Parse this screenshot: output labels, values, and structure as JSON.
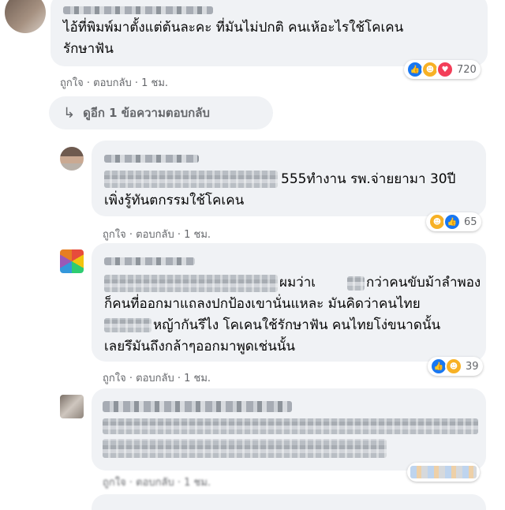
{
  "comments": [
    {
      "text_lines": [
        "ไอ้ที่พิมพ์มาตั้งแต่ต้นละคะ ที่มันไม่ปกติ คนเห้อะไรใช้โคเคน",
        "รักษาฟัน"
      ],
      "like_label": "ถูกใจ",
      "reply_label": "ตอบกลับ",
      "time": "1 ชม.",
      "reaction_icons": [
        "like-icon",
        "haha-icon",
        "love-icon"
      ],
      "reaction_count": "720"
    },
    {
      "text_lines": [
        "555ทำงาน รพ.จ่ายยามา 30ปี",
        "เพิ่งรู้ทันตกรรมใช้โคเคน"
      ],
      "like_label": "ถูกใจ",
      "reply_label": "ตอบกลับ",
      "time": "1 ชม.",
      "reaction_icons": [
        "haha-icon",
        "like-icon"
      ],
      "reaction_count": "65"
    },
    {
      "text_lines": [
        "ผมว่าเ",
        "กว่าคนขับม้าลำพอง",
        "ก็คนที่ออกมาแถลงปกป้องเขานั่นแหละ มันคิดว่าคนไทย",
        "หญ้ากันรึไง โคเคนใช้รักษาฟัน คนไทยโง่ขนาดนั้น",
        "เลยรึมันถึงกล้าๆออกมาพูดเช่นนั้น"
      ],
      "like_label": "ถูกใจ",
      "reply_label": "ตอบกลับ",
      "time": "1 ชม.",
      "reaction_icons": [
        "like-icon",
        "haha-icon"
      ],
      "reaction_count": "39"
    },
    {
      "like_label": "ถูกใจ",
      "reply_label": "ตอบกลับ",
      "time": "1 ชม."
    }
  ],
  "view_more_replies": "ดูอีก 1 ข้อความตอบกลับ",
  "separator": "·",
  "icons": {
    "reply_arrow": "reply-arrow-icon"
  }
}
